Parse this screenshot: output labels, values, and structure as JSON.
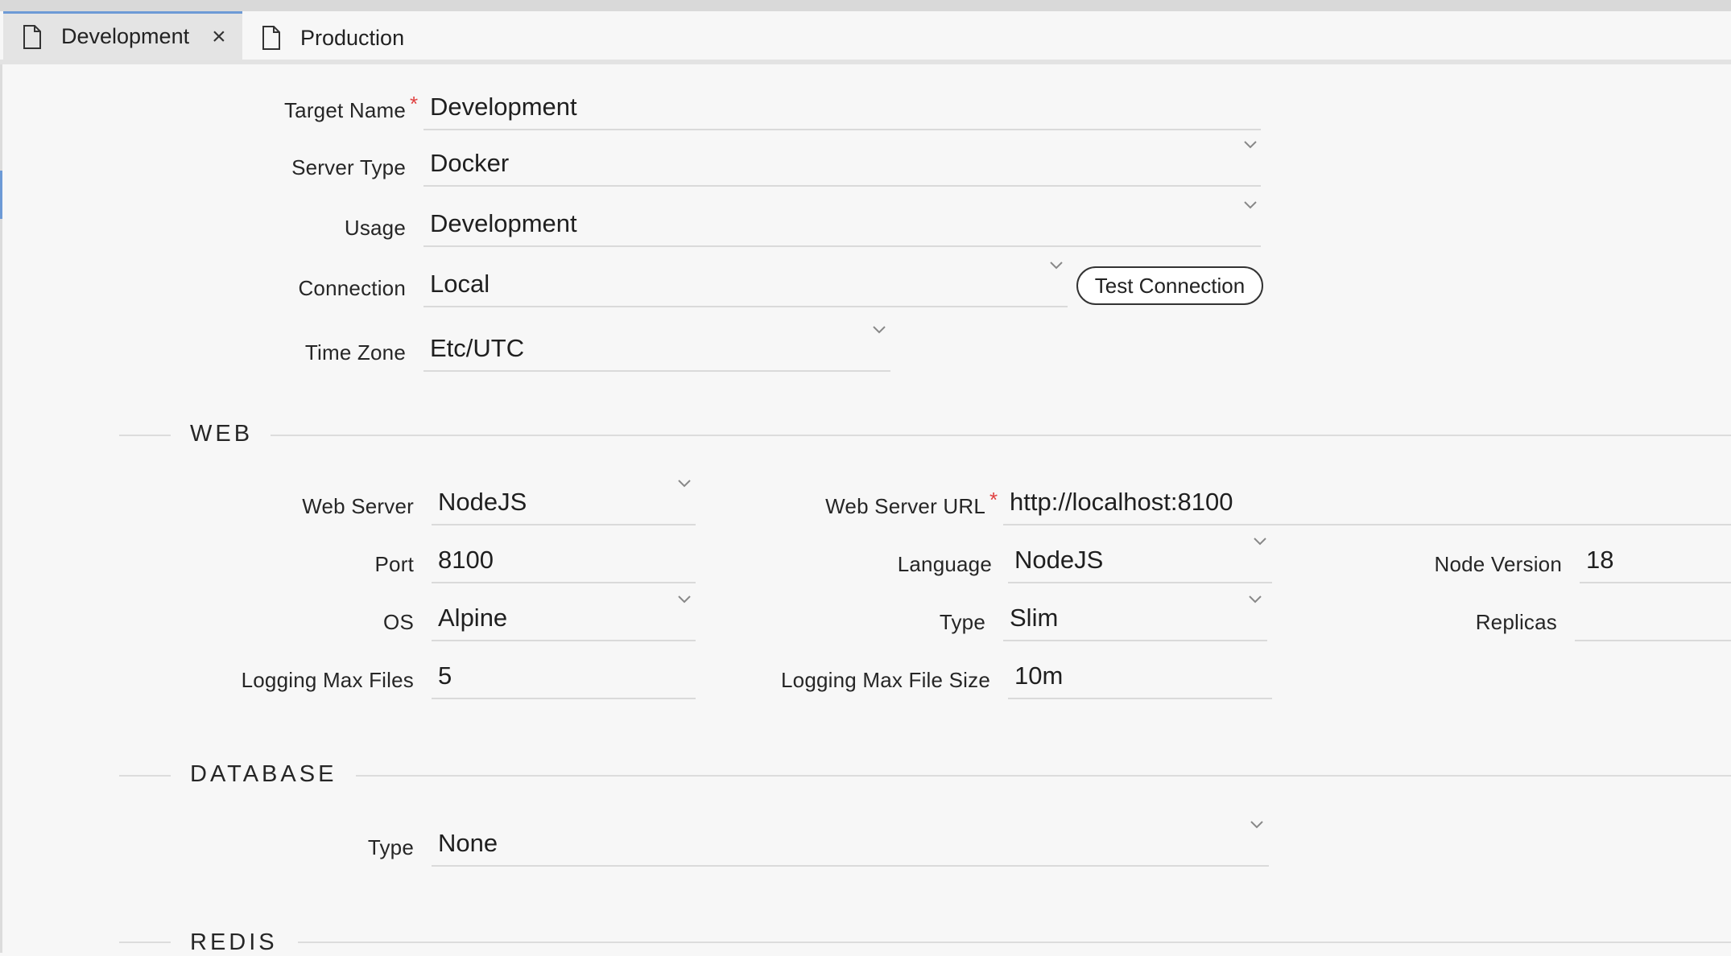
{
  "tabs": [
    {
      "label": "Development",
      "active": true,
      "closable": true
    },
    {
      "label": "Production",
      "active": false,
      "closable": false
    }
  ],
  "target": {
    "target_name_label": "Target Name",
    "target_name_value": "Development",
    "server_type_label": "Server Type",
    "server_type_value": "Docker",
    "usage_label": "Usage",
    "usage_value": "Development",
    "connection_label": "Connection",
    "connection_value": "Local",
    "test_connection_label": "Test Connection",
    "time_zone_label": "Time Zone",
    "time_zone_value": "Etc/UTC"
  },
  "web": {
    "section_title": "WEB",
    "web_server_label": "Web Server",
    "web_server_value": "NodeJS",
    "web_server_url_label": "Web Server URL",
    "web_server_url_value": "http://localhost:8100",
    "port_label": "Port",
    "port_value": "8100",
    "language_label": "Language",
    "language_value": "NodeJS",
    "node_version_label": "Node Version",
    "node_version_value": "18",
    "os_label": "OS",
    "os_value": "Alpine",
    "type_label": "Type",
    "type_value": "Slim",
    "replicas_label": "Replicas",
    "replicas_value": "",
    "logging_max_files_label": "Logging Max Files",
    "logging_max_files_value": "5",
    "logging_max_file_size_label": "Logging Max File Size",
    "logging_max_file_size_value": "10m"
  },
  "database": {
    "section_title": "DATABASE",
    "type_label": "Type",
    "type_value": "None"
  },
  "redis": {
    "section_title": "REDIS"
  },
  "icons": {
    "tab_icon": "document-icon",
    "close": "close-icon",
    "dropdown": "chevron-down-icon"
  },
  "colors": {
    "accent": "#6d9ad6",
    "required": "#e04141"
  }
}
